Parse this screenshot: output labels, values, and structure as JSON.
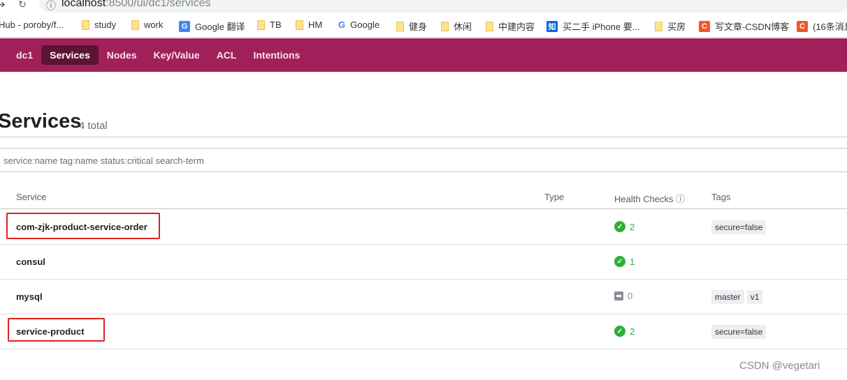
{
  "browser": {
    "url_host": "localhost",
    "url_path": ":8500/ui/dc1/services"
  },
  "bookmarks": [
    {
      "label": "Hub - poroby/f...",
      "icon": "none"
    },
    {
      "label": "study",
      "icon": "folder"
    },
    {
      "label": "work",
      "icon": "folder"
    },
    {
      "label": "Google 翻译",
      "icon": "google-translate"
    },
    {
      "label": "TB",
      "icon": "folder"
    },
    {
      "label": "HM",
      "icon": "folder"
    },
    {
      "label": "Google",
      "icon": "google"
    },
    {
      "label": "健身",
      "icon": "folder"
    },
    {
      "label": "休闲",
      "icon": "folder"
    },
    {
      "label": "中建内容",
      "icon": "folder"
    },
    {
      "label": "买二手 iPhone 要...",
      "icon": "zhihu"
    },
    {
      "label": "买房",
      "icon": "folder"
    },
    {
      "label": "写文章-CSDN博客",
      "icon": "csdn"
    },
    {
      "label": "(16条消息",
      "icon": "csdn"
    }
  ],
  "nav": {
    "datacenter": "dc1",
    "items": [
      "Services",
      "Nodes",
      "Key/Value",
      "ACL",
      "Intentions"
    ],
    "active": "Services"
  },
  "page": {
    "title": "Services",
    "total": "4 total",
    "search_placeholder": "service:name tag:name status:critical search-term"
  },
  "table": {
    "headers": {
      "service": "Service",
      "type": "Type",
      "health": "Health Checks",
      "tags": "Tags"
    },
    "rows": [
      {
        "name": "com-zjk-product-service-order",
        "type": "",
        "health": "2",
        "status": "passing",
        "tags": [
          "secure=false"
        ]
      },
      {
        "name": "consul",
        "type": "",
        "health": "1",
        "status": "passing",
        "tags": []
      },
      {
        "name": "mysql",
        "type": "",
        "health": "0",
        "status": "none",
        "tags": [
          "master",
          "v1"
        ]
      },
      {
        "name": "service-product",
        "type": "",
        "health": "2",
        "status": "passing",
        "tags": [
          "secure=false"
        ]
      }
    ]
  },
  "watermark": "CSDN @vegetari",
  "colors": {
    "brand": "#a1205a",
    "active_nav": "#5c1434",
    "passing": "#2eb039",
    "highlight": "#e0201f"
  }
}
